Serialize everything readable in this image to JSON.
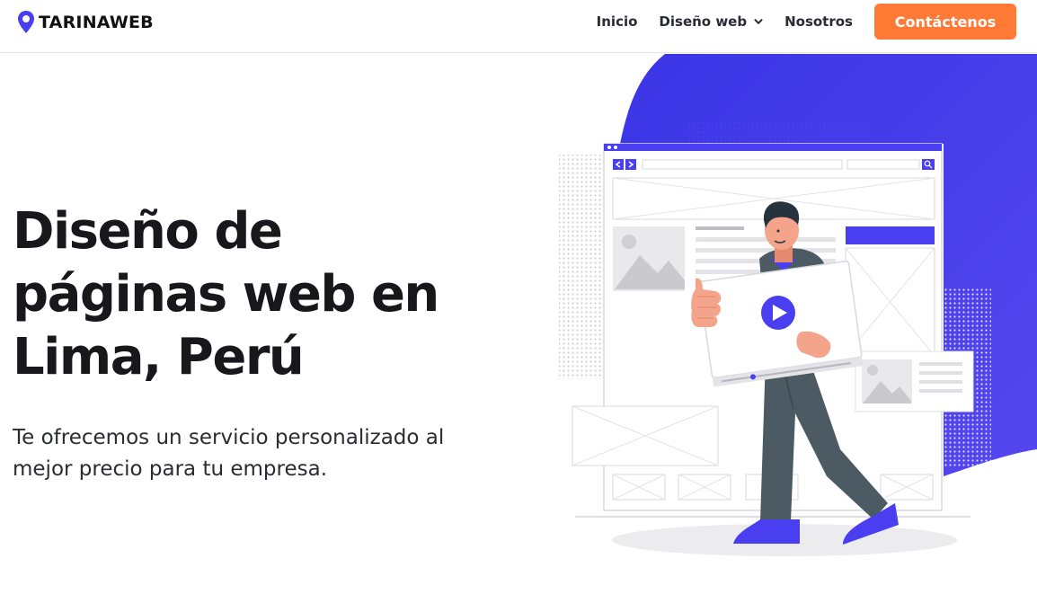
{
  "header": {
    "brand": "TARINAWEB",
    "nav": [
      {
        "label": "Inicio"
      },
      {
        "label": "Diseño web"
      },
      {
        "label": "Nosotros"
      }
    ],
    "cta_label": "Contáctenos"
  },
  "hero": {
    "title_lines": [
      "Diseño de",
      "páginas web en",
      "Lima, Perú"
    ],
    "subtitle_lines": [
      "Te ofrecemos un servicio personalizado al",
      "mejor precio para tu empresa."
    ]
  },
  "colors": {
    "accent": "#ff7a35",
    "illustration_blue": "#4a3ff0",
    "text_dark": "#17171c"
  },
  "icons": {
    "logo": "location-pin-icon",
    "dropdown": "chevron-down-icon",
    "play": "play-icon",
    "search": "search-icon"
  }
}
